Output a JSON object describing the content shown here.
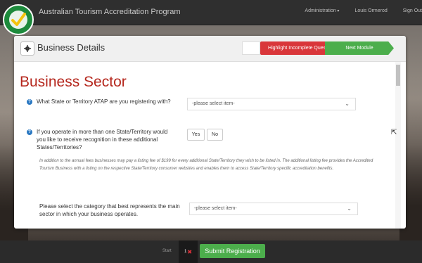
{
  "header": {
    "app_title": "Australian Tourism Accreditation Program",
    "nav": [
      "Administration",
      "Louis Ormerod",
      "Sign Out"
    ],
    "logo_text": "Accredited Tourism Business Australia"
  },
  "panel": {
    "title": "Business Details",
    "highlight_label": "Highlight Incomplete Questions",
    "next_label": "Next Module"
  },
  "section": {
    "title": "Business Sector",
    "q1": {
      "text": "What State or Territory ATAP are you registering with?",
      "select_value": "-please select item-"
    },
    "q2": {
      "text": "If you operate in more than one State/Territory would you like to receive recognition in these additional States/Territories?",
      "yes": "Yes",
      "no": "No",
      "note": "In addition to the annual fees businesses may pay a listing fee of $199 for every additional State/Territory they wish to be listed in. The additional listing fee provides the Accredited Tourism Business with a listing on the respective State/Territory consumer websites and enables them to access State/Territory specific accreditation benefits."
    },
    "q3": {
      "text": "Please select the category that best represents the main sector in which your business operates.",
      "select_value": "-please select item-"
    }
  },
  "footer": {
    "start_label": "Start",
    "count": "1",
    "error_mark": "✖",
    "submit_label": "Submit Registration"
  },
  "colors": {
    "accent_red": "#d9363a",
    "accent_green": "#4cae4c",
    "title_red": "#b5271d",
    "info_blue": "#2a78c2"
  }
}
